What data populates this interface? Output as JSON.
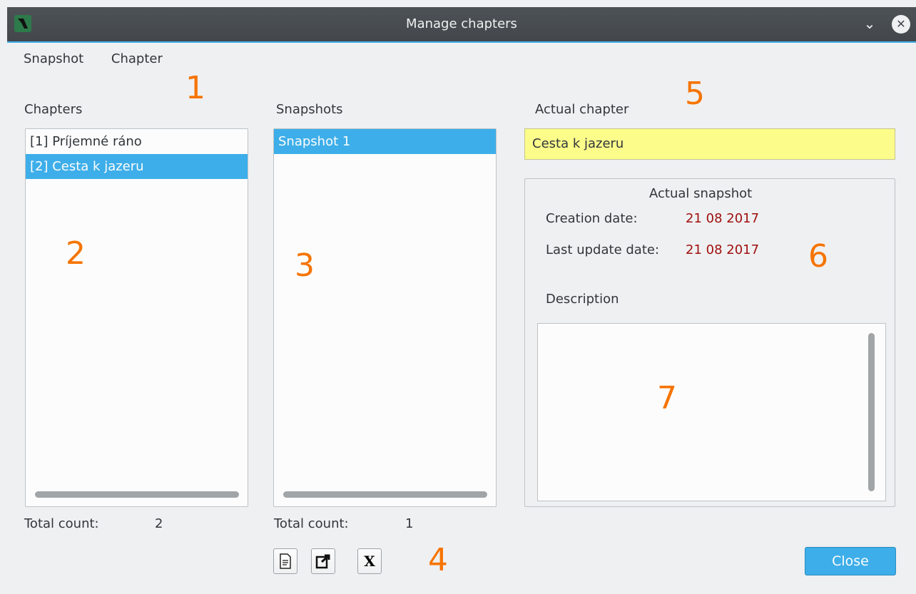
{
  "window": {
    "title": "Manage chapters"
  },
  "menu": [
    "Snapshot",
    "Chapter"
  ],
  "chapters": {
    "label": "Chapters",
    "items": [
      "[1] Príjemné ráno",
      "[2] Cesta k jazeru"
    ],
    "selected": 1,
    "total_label": "Total count:",
    "total_value": "2"
  },
  "snapshots": {
    "label": "Snapshots",
    "items": [
      "Snapshot 1"
    ],
    "selected": 0,
    "total_label": "Total count:",
    "total_value": "1"
  },
  "actual_chapter": {
    "label": "Actual chapter",
    "value": "Cesta k jazeru"
  },
  "actual_snapshot": {
    "title": "Actual snapshot",
    "creation_label": "Creation date:",
    "creation_value": "21 08 2017",
    "update_label": "Last update date:",
    "update_value": "21 08 2017",
    "description_label": "Description"
  },
  "toolbar": {
    "new_icon": "document-icon",
    "export_icon": "export-icon",
    "delete_label": "X"
  },
  "annotations": [
    "1",
    "2",
    "3",
    "4",
    "5",
    "6",
    "7"
  ],
  "buttons": {
    "close": "Close"
  },
  "colors": {
    "accent": "#3daee9",
    "highlight_field": "#fcfc8a",
    "annotation": "#f67400",
    "date": "#a01010"
  }
}
